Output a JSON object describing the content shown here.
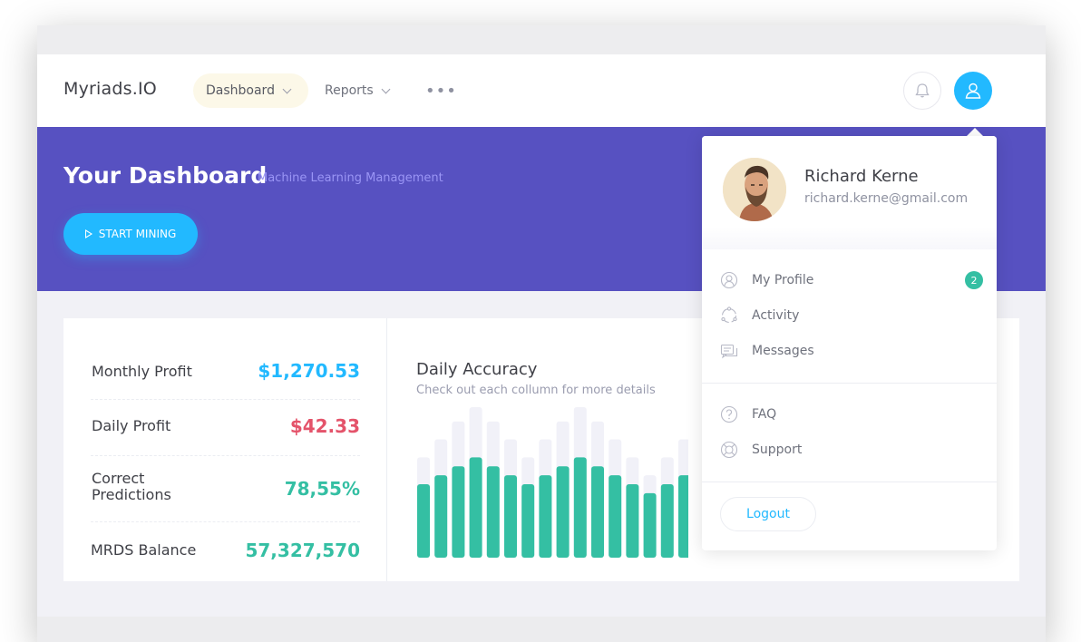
{
  "header": {
    "logo": "Myriads.IO",
    "nav": [
      {
        "label": "Dashboard",
        "active": true
      },
      {
        "label": "Reports",
        "active": false
      }
    ],
    "more_icon": "more-dots-icon",
    "bell_icon": "bell-icon",
    "user_icon": "user-icon"
  },
  "banner": {
    "title": "Your Dashboard",
    "subtitle": "Machine Learning Management",
    "button_label": "START MINING",
    "button_icon": "play-icon",
    "background": "#5751c1",
    "accent": "#22b9ff"
  },
  "stats": [
    {
      "label": "Monthly Profit",
      "value": "$1,270.53",
      "color": "#22b9ff"
    },
    {
      "label": "Daily Profit",
      "value": "$42.33",
      "color": "#e4536a"
    },
    {
      "label": "Correct Predictions",
      "value": "78,55%",
      "color": "#34bfa3"
    },
    {
      "label": "MRDS Balance",
      "value": "57,327,570",
      "color": "#34bfa3"
    }
  ],
  "chart": {
    "title": "Daily Accuracy",
    "subtitle": "Check out each collumn for more details"
  },
  "chart_data": {
    "type": "bar",
    "series": [
      {
        "color": "#34bfa3",
        "values": [
          82,
          92,
          102,
          112,
          102,
          92,
          82,
          92,
          102,
          112,
          102,
          92,
          82,
          72,
          82,
          92
        ]
      },
      {
        "color": "#f1f1f8",
        "values": [
          112,
          132,
          152,
          168,
          152,
          132,
          112,
          132,
          152,
          168,
          152,
          132,
          112,
          92,
          112,
          132
        ]
      }
    ],
    "ylim": [
      0,
      170
    ],
    "grid": false,
    "legend": "none"
  },
  "dropdown": {
    "name": "Richard Kerne",
    "email": "richard.kerne@gmail.com",
    "items": [
      {
        "label": "My Profile",
        "icon": "profile-icon",
        "badge": "2"
      },
      {
        "label": "Activity",
        "icon": "activity-icon"
      },
      {
        "label": "Messages",
        "icon": "messages-icon"
      },
      {
        "label": "FAQ",
        "icon": "question-icon"
      },
      {
        "label": "Support",
        "icon": "lifebuoy-icon"
      }
    ],
    "logout_label": "Logout"
  }
}
